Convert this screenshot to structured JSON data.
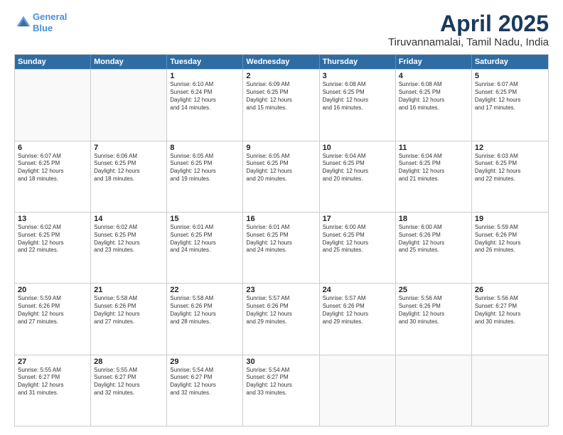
{
  "logo": {
    "line1": "General",
    "line2": "Blue"
  },
  "title": "April 2025",
  "subtitle": "Tiruvannamalai, Tamil Nadu, India",
  "header": {
    "days": [
      "Sunday",
      "Monday",
      "Tuesday",
      "Wednesday",
      "Thursday",
      "Friday",
      "Saturday"
    ]
  },
  "weeks": [
    [
      {
        "day": "",
        "info": ""
      },
      {
        "day": "",
        "info": ""
      },
      {
        "day": "1",
        "info": "Sunrise: 6:10 AM\nSunset: 6:24 PM\nDaylight: 12 hours\nand 14 minutes."
      },
      {
        "day": "2",
        "info": "Sunrise: 6:09 AM\nSunset: 6:25 PM\nDaylight: 12 hours\nand 15 minutes."
      },
      {
        "day": "3",
        "info": "Sunrise: 6:08 AM\nSunset: 6:25 PM\nDaylight: 12 hours\nand 16 minutes."
      },
      {
        "day": "4",
        "info": "Sunrise: 6:08 AM\nSunset: 6:25 PM\nDaylight: 12 hours\nand 16 minutes."
      },
      {
        "day": "5",
        "info": "Sunrise: 6:07 AM\nSunset: 6:25 PM\nDaylight: 12 hours\nand 17 minutes."
      }
    ],
    [
      {
        "day": "6",
        "info": "Sunrise: 6:07 AM\nSunset: 6:25 PM\nDaylight: 12 hours\nand 18 minutes."
      },
      {
        "day": "7",
        "info": "Sunrise: 6:06 AM\nSunset: 6:25 PM\nDaylight: 12 hours\nand 18 minutes."
      },
      {
        "day": "8",
        "info": "Sunrise: 6:05 AM\nSunset: 6:25 PM\nDaylight: 12 hours\nand 19 minutes."
      },
      {
        "day": "9",
        "info": "Sunrise: 6:05 AM\nSunset: 6:25 PM\nDaylight: 12 hours\nand 20 minutes."
      },
      {
        "day": "10",
        "info": "Sunrise: 6:04 AM\nSunset: 6:25 PM\nDaylight: 12 hours\nand 20 minutes."
      },
      {
        "day": "11",
        "info": "Sunrise: 6:04 AM\nSunset: 6:25 PM\nDaylight: 12 hours\nand 21 minutes."
      },
      {
        "day": "12",
        "info": "Sunrise: 6:03 AM\nSunset: 6:25 PM\nDaylight: 12 hours\nand 22 minutes."
      }
    ],
    [
      {
        "day": "13",
        "info": "Sunrise: 6:02 AM\nSunset: 6:25 PM\nDaylight: 12 hours\nand 22 minutes."
      },
      {
        "day": "14",
        "info": "Sunrise: 6:02 AM\nSunset: 6:25 PM\nDaylight: 12 hours\nand 23 minutes."
      },
      {
        "day": "15",
        "info": "Sunrise: 6:01 AM\nSunset: 6:25 PM\nDaylight: 12 hours\nand 24 minutes."
      },
      {
        "day": "16",
        "info": "Sunrise: 6:01 AM\nSunset: 6:25 PM\nDaylight: 12 hours\nand 24 minutes."
      },
      {
        "day": "17",
        "info": "Sunrise: 6:00 AM\nSunset: 6:25 PM\nDaylight: 12 hours\nand 25 minutes."
      },
      {
        "day": "18",
        "info": "Sunrise: 6:00 AM\nSunset: 6:26 PM\nDaylight: 12 hours\nand 25 minutes."
      },
      {
        "day": "19",
        "info": "Sunrise: 5:59 AM\nSunset: 6:26 PM\nDaylight: 12 hours\nand 26 minutes."
      }
    ],
    [
      {
        "day": "20",
        "info": "Sunrise: 5:59 AM\nSunset: 6:26 PM\nDaylight: 12 hours\nand 27 minutes."
      },
      {
        "day": "21",
        "info": "Sunrise: 5:58 AM\nSunset: 6:26 PM\nDaylight: 12 hours\nand 27 minutes."
      },
      {
        "day": "22",
        "info": "Sunrise: 5:58 AM\nSunset: 6:26 PM\nDaylight: 12 hours\nand 28 minutes."
      },
      {
        "day": "23",
        "info": "Sunrise: 5:57 AM\nSunset: 6:26 PM\nDaylight: 12 hours\nand 29 minutes."
      },
      {
        "day": "24",
        "info": "Sunrise: 5:57 AM\nSunset: 6:26 PM\nDaylight: 12 hours\nand 29 minutes."
      },
      {
        "day": "25",
        "info": "Sunrise: 5:56 AM\nSunset: 6:26 PM\nDaylight: 12 hours\nand 30 minutes."
      },
      {
        "day": "26",
        "info": "Sunrise: 5:56 AM\nSunset: 6:27 PM\nDaylight: 12 hours\nand 30 minutes."
      }
    ],
    [
      {
        "day": "27",
        "info": "Sunrise: 5:55 AM\nSunset: 6:27 PM\nDaylight: 12 hours\nand 31 minutes."
      },
      {
        "day": "28",
        "info": "Sunrise: 5:55 AM\nSunset: 6:27 PM\nDaylight: 12 hours\nand 32 minutes."
      },
      {
        "day": "29",
        "info": "Sunrise: 5:54 AM\nSunset: 6:27 PM\nDaylight: 12 hours\nand 32 minutes."
      },
      {
        "day": "30",
        "info": "Sunrise: 5:54 AM\nSunset: 6:27 PM\nDaylight: 12 hours\nand 33 minutes."
      },
      {
        "day": "",
        "info": ""
      },
      {
        "day": "",
        "info": ""
      },
      {
        "day": "",
        "info": ""
      }
    ]
  ]
}
